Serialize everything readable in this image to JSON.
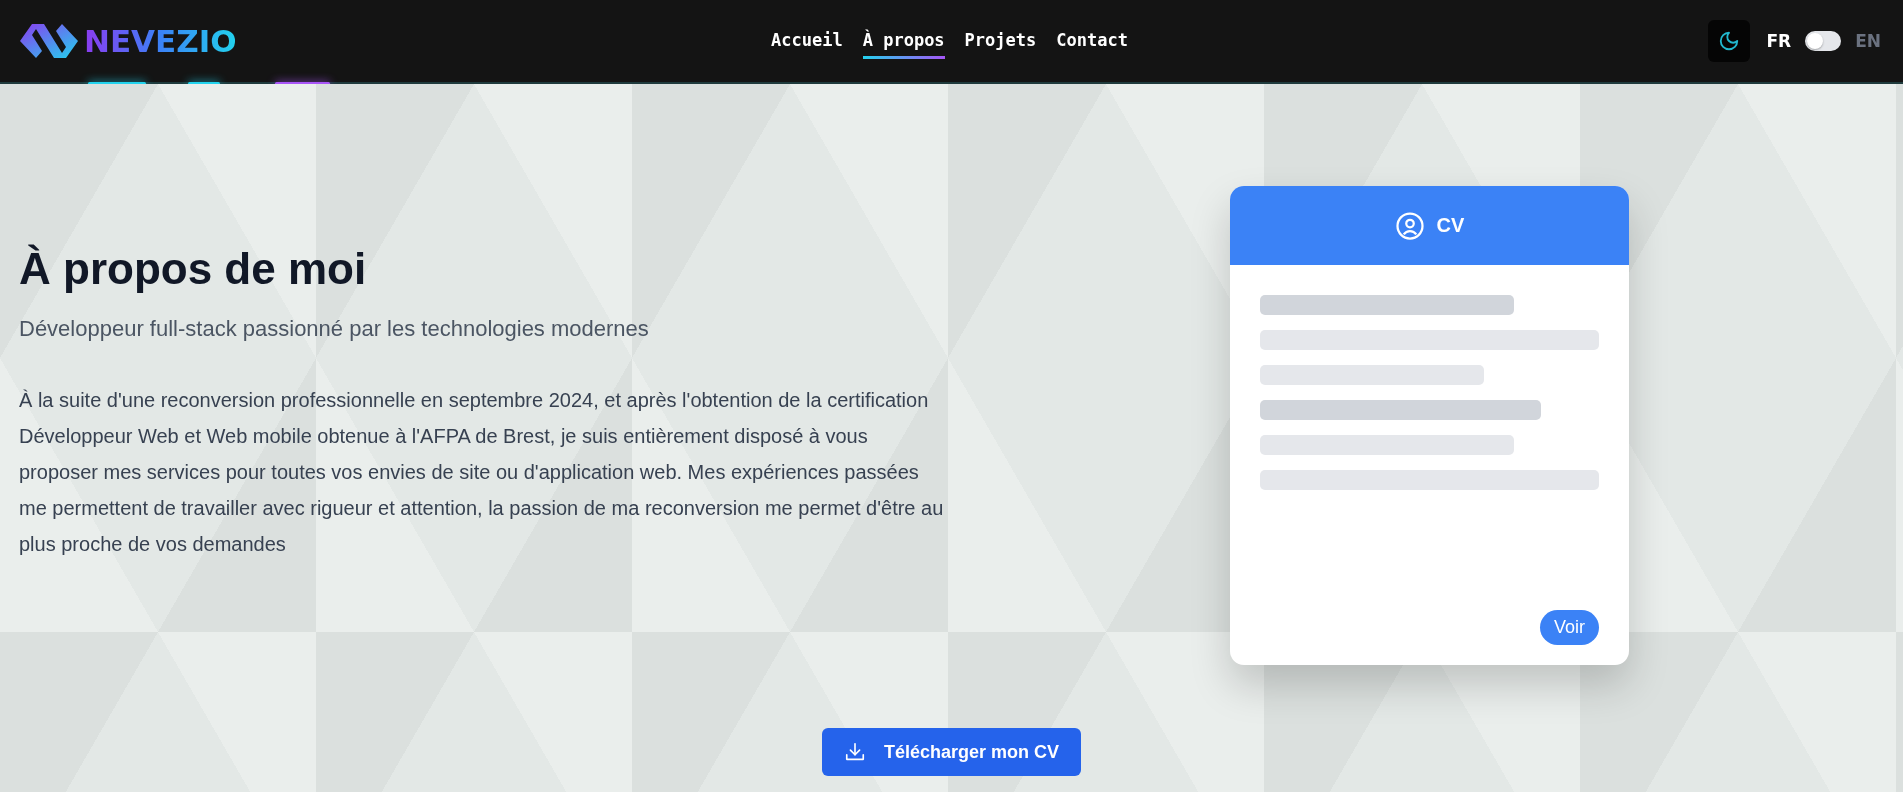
{
  "header": {
    "logo_text": "NEVEZIO",
    "nav": [
      {
        "label": "Accueil",
        "selected": false
      },
      {
        "label": "À propos",
        "selected": true
      },
      {
        "label": "Projets",
        "selected": false
      },
      {
        "label": "Contact",
        "selected": false
      }
    ],
    "language": [
      {
        "label": "FR",
        "selected": true
      },
      {
        "label": "EN",
        "selected": false
      }
    ]
  },
  "about": {
    "title": "À propos de moi",
    "subtitle": "Développeur full-stack passionné par les technologies modernes",
    "paragraph": "À la suite d'une reconversion professionnelle en septembre 2024, et après l'obtention de la certification Développeur Web et Web mobile obtenue à l'AFPA de Brest, je suis entièrement disposé à vous proposer mes services pour toutes vos envies de site ou d'application web. Mes expériences passées me permettent de travailler avec rigueur et attention, la passion de ma reconversion me permet d'être au plus proche de vos demandes"
  },
  "cv_card": {
    "title": "CV",
    "button": "Voir"
  },
  "download_button": "Télécharger mon CV"
}
